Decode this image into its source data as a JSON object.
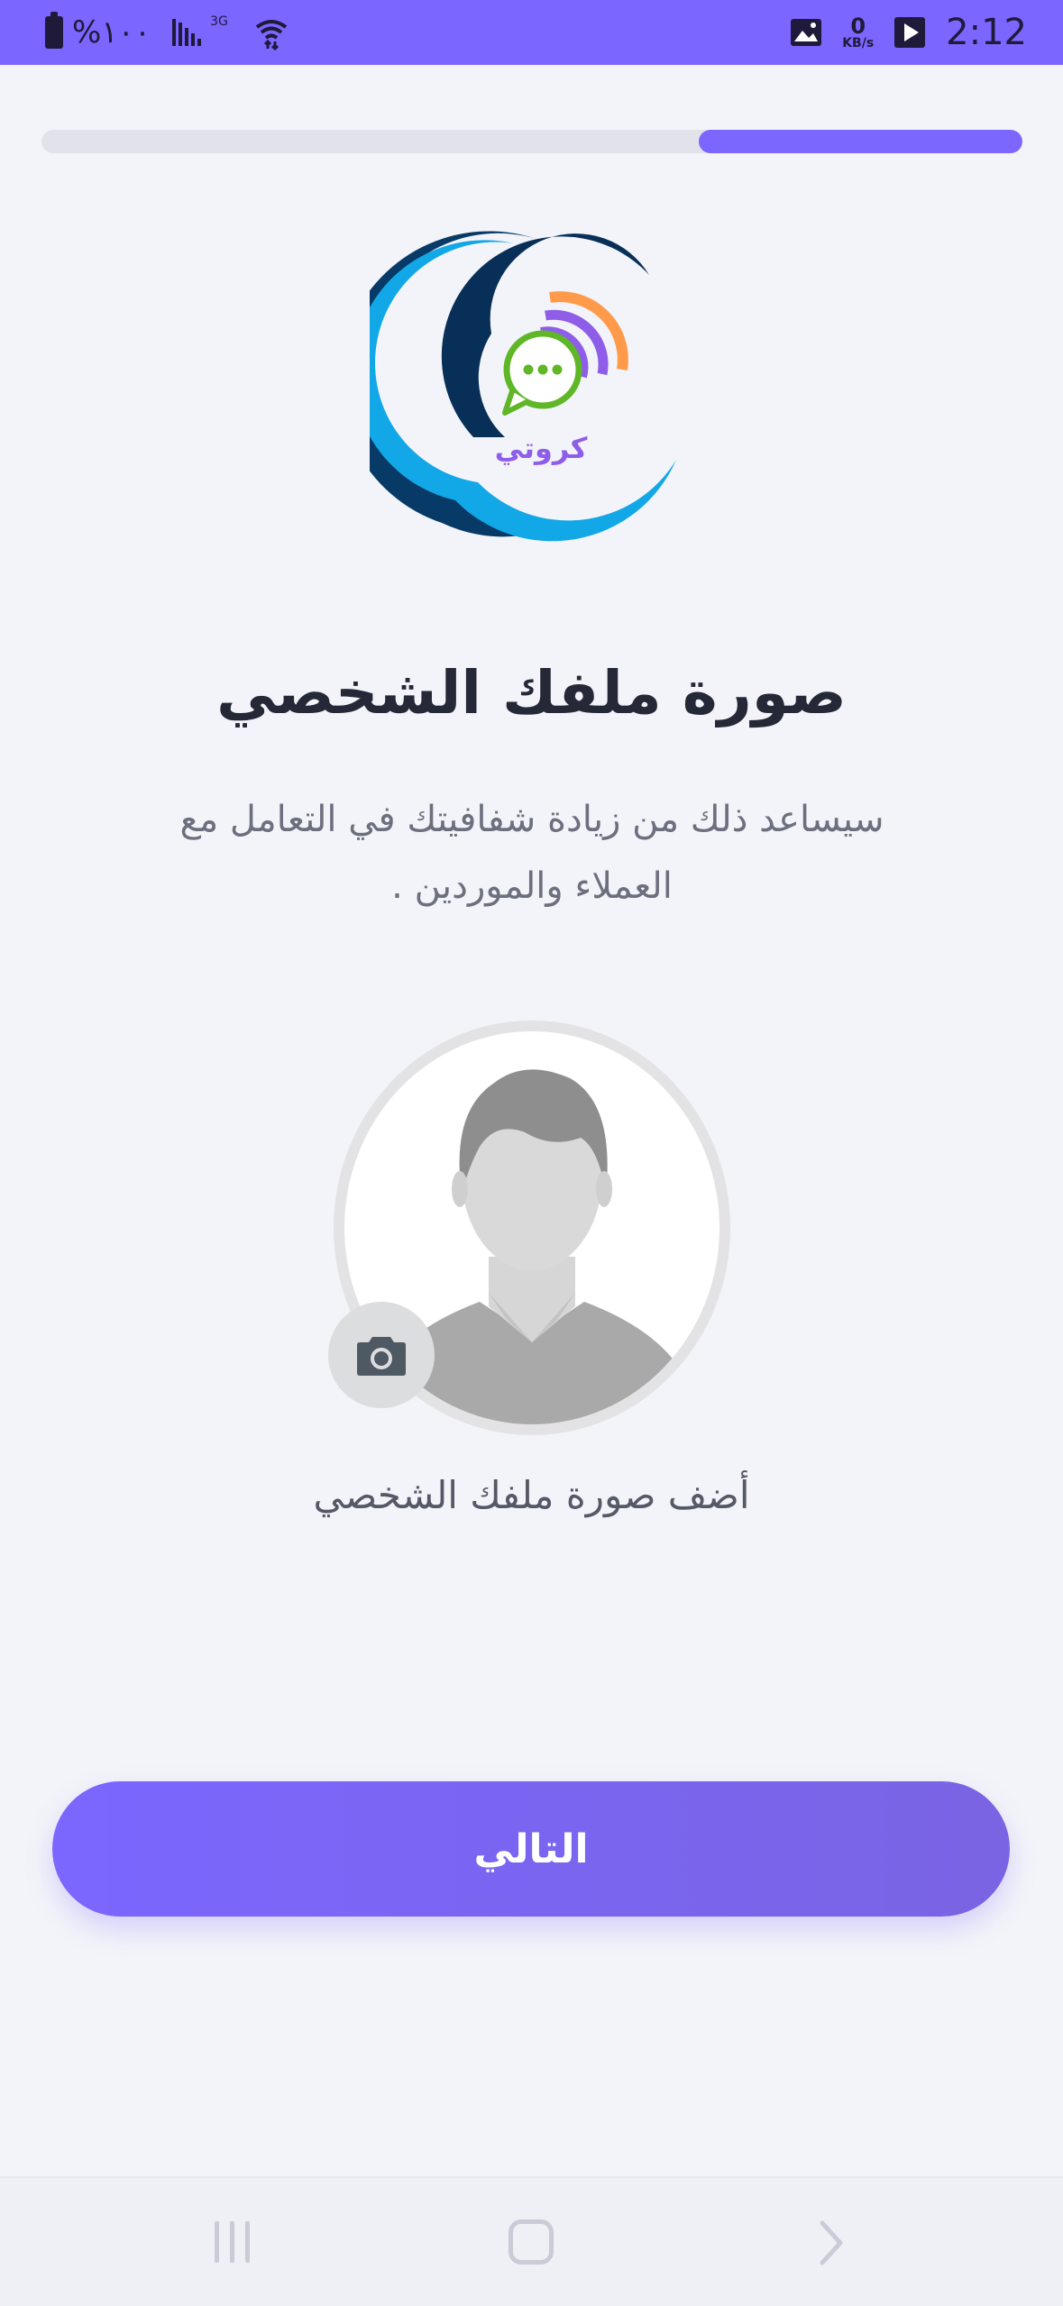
{
  "status_bar": {
    "battery_text": "%١٠٠",
    "network_type": "3G",
    "data_rate_value": "0",
    "data_rate_unit": "KB/s",
    "time": "2:12"
  },
  "progress": {
    "value": 0.33
  },
  "logo": {
    "text": "كروتي"
  },
  "title": "صورة ملفك الشخصي",
  "subtitle": "سيساعد ذلك من زيادة شفافيتك في التعامل مع العملاء والموردين .",
  "avatar": {
    "add_label": "أضف صورة ملفك الشخصي"
  },
  "next_button": {
    "label": "التالي"
  },
  "colors": {
    "accent": "#7b66ff",
    "background": "#f3f4f9",
    "title": "#252836"
  }
}
